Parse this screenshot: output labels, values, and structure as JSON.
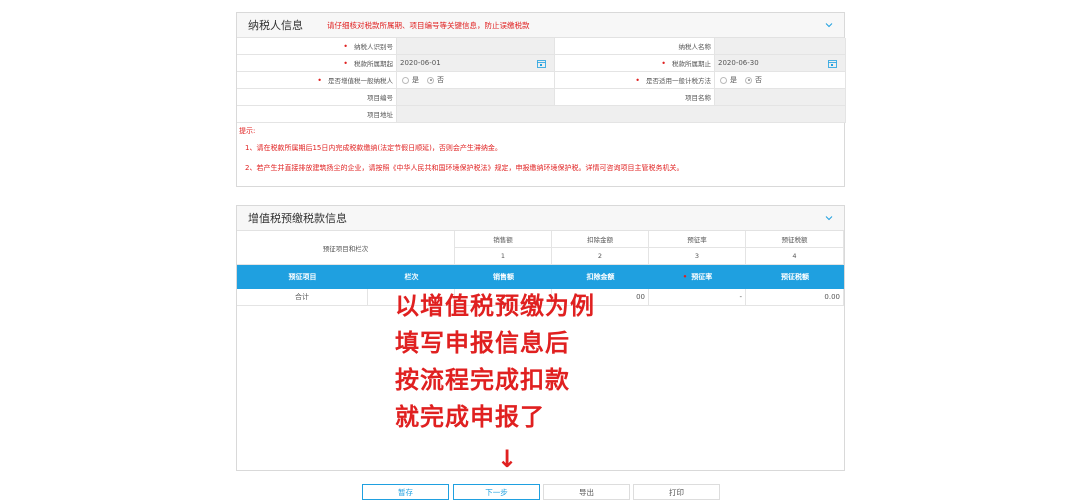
{
  "taxpayer": {
    "title": "纳税人信息",
    "note": "请仔细核对税款所属期、项目编号等关键信息，防止误缴税款",
    "fields": {
      "id_label": "纳税人识别号",
      "name_label": "纳税人名称",
      "period_start_label": "税款所属期起",
      "period_start_value": "2020-06-01",
      "period_end_label": "税款所属期止",
      "period_end_value": "2020-06-30",
      "general_taxpayer_label": "是否增值税一般纳税人",
      "general_method_label": "是否适用一般计税方法",
      "yes": "是",
      "no": "否",
      "project_no_label": "项目编号",
      "project_name_label": "项目名称",
      "project_addr_label": "项目地址"
    },
    "tips": {
      "title": "提示:",
      "line1": "1、请在税款所属期后15日内完成税款缴纳(法定节假日顺延)，否则会产生滞纳金。",
      "line2": "2、若产生并直接排放建筑扬尘的企业，请按照《中华人民共和国环境保护税法》规定，申报缴纳环境保护税。详情可咨询项目主管税务机关。"
    }
  },
  "vat": {
    "title": "增值税预缴税款信息",
    "head": {
      "project_and_row": "预征项目和栏次",
      "sales": "销售额",
      "deduction": "扣除金额",
      "rate": "预征率",
      "tax": "预征税额",
      "n1": "1",
      "n2": "2",
      "n3": "3",
      "n4": "4"
    },
    "bar": {
      "item": "预征项目",
      "row": "栏次",
      "sales": "销售额",
      "deduction": "扣除金额",
      "rate": "预征率",
      "tax": "预征税额"
    },
    "total": {
      "label": "合计",
      "deduction_tail": "00",
      "rate": "-",
      "tax": "0.00"
    }
  },
  "overlay": {
    "line1": "以增值税预缴为例",
    "line2": "填写申报信息后",
    "line3": "按流程完成扣款",
    "line4": "就完成申报了",
    "arrow": "↓"
  },
  "buttons": {
    "save": "暂存",
    "next": "下一步",
    "export": "导出",
    "print": "打印"
  },
  "colors": {
    "accent": "#1fa0e0",
    "warning": "#e02020"
  }
}
